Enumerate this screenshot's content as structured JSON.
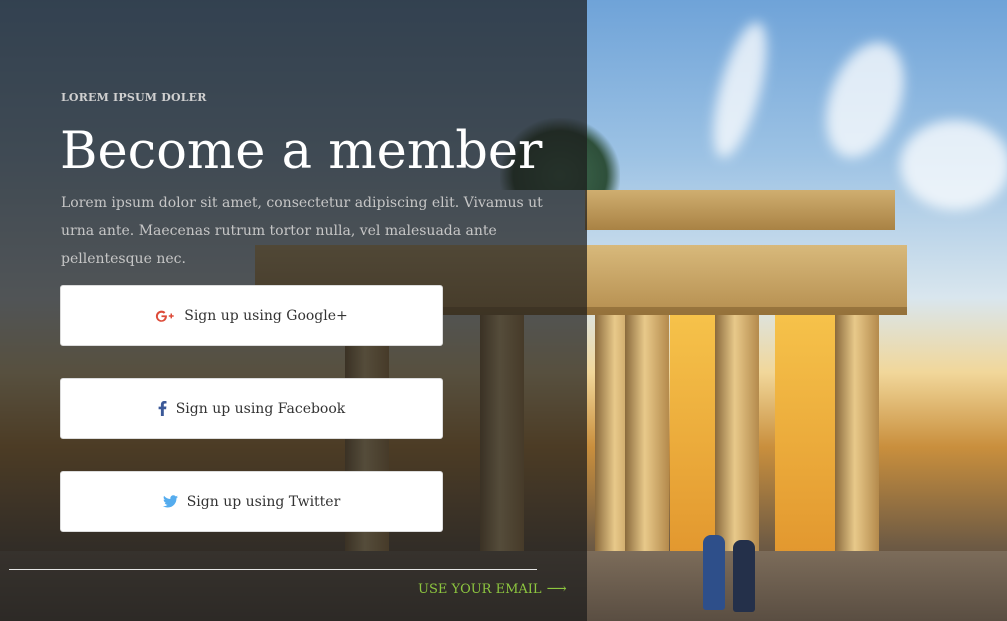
{
  "hero": {
    "eyebrow": "LOREM IPSUM DOLER",
    "title": "Become a member",
    "description": "Lorem ipsum dolor sit amet, consectetur adipiscing elit. Vivamus ut urna ante. Maecenas rutrum tortor nulla, vel malesuada ante pellentesque nec."
  },
  "signup": {
    "google_label": "Sign up using Google+",
    "facebook_label": "Sign up using Facebook",
    "twitter_label": "Sign up using Twitter"
  },
  "footer": {
    "email_link": "USE YOUR EMAIL",
    "email_arrow": "⟶"
  },
  "icons": {
    "google": "google-plus-icon",
    "facebook": "facebook-icon",
    "twitter": "twitter-icon"
  },
  "colors": {
    "google": "#dd4b39",
    "facebook": "#3b5998",
    "twitter": "#55acee",
    "accent": "#8dc63f"
  }
}
